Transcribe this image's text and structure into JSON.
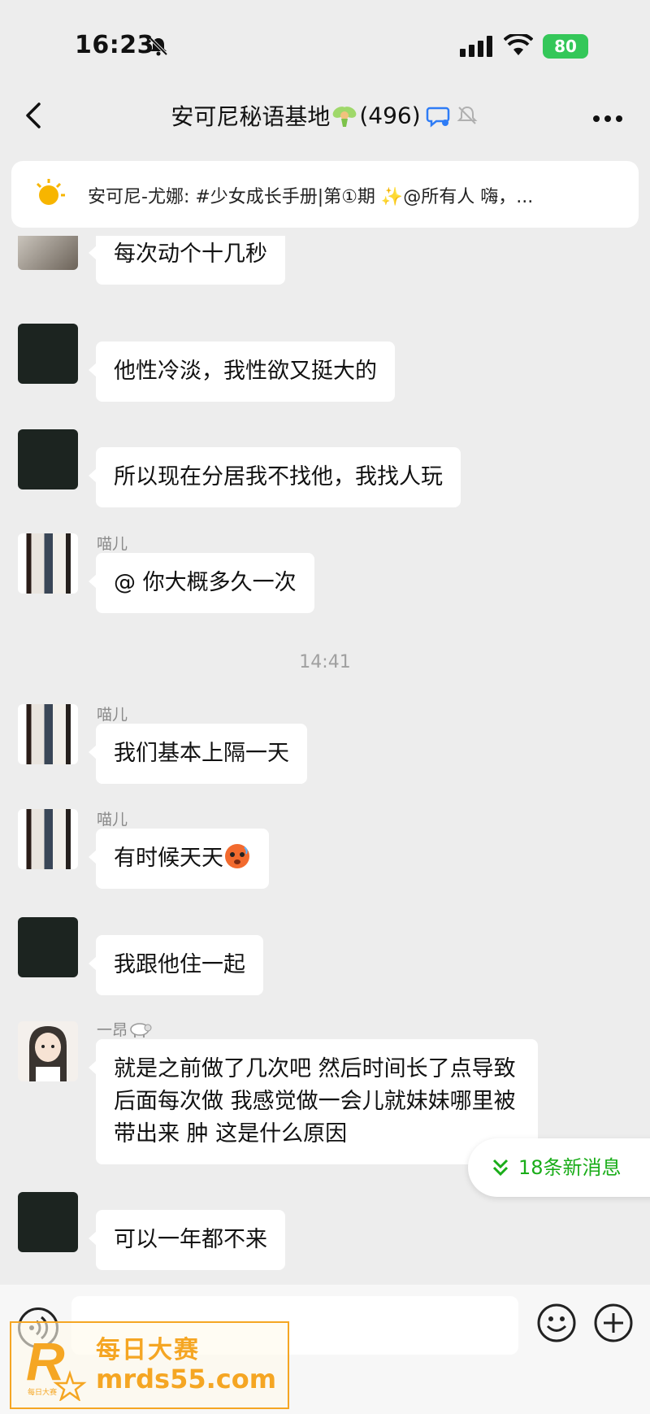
{
  "status_bar": {
    "time": "16:23",
    "battery": "80"
  },
  "header": {
    "title": "安可尼秘语基地",
    "member_count": "(496)"
  },
  "notice": {
    "text": "安可尼-尤娜: #少女成长手册|第①期 ✨@所有人  嗨，..."
  },
  "messages": [
    {
      "sender": "",
      "text": "每次动个十几秒"
    },
    {
      "sender": "",
      "text": "他性冷淡，我性欲又挺大的"
    },
    {
      "sender": "",
      "text": "所以现在分居我不找他，我找人玩"
    },
    {
      "sender": "喵儿",
      "text": "@ 你大概多久一次"
    },
    {
      "sender": "喵儿",
      "text": "我们基本上隔一天"
    },
    {
      "sender": "喵儿",
      "text": "有时候天天"
    },
    {
      "sender": "",
      "text": "我跟他住一起"
    },
    {
      "sender": "一昂",
      "text": "就是之前做了几次吧 然后时间长了点导致后面每次做 我感觉做一会儿就妹妹哪里被带出来 肿 这是什么原因"
    },
    {
      "sender": "",
      "text": "可以一年都不来"
    }
  ],
  "timestamp": "14:41",
  "new_messages": "18条新消息",
  "watermark": {
    "cn": "每日大赛",
    "url": "mrds55.com",
    "logo_small": "每日大赛"
  },
  "colors": {
    "accent": "#1aad19",
    "background": "#ededed",
    "battery": "#34c759",
    "watermark": "#f5a623"
  }
}
